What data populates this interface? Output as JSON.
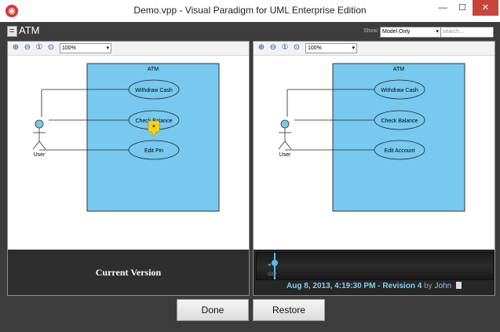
{
  "window": {
    "title": "Demo.vpp - Visual Paradigm for UML Enterprise Edition",
    "minimize": "—",
    "maximize": "☐",
    "close": "✕"
  },
  "header": {
    "diagram_name": "ATM",
    "show_label": "Show:",
    "show_value": "Model Only",
    "search_placeholder": "search..."
  },
  "zoom": {
    "value": "100%"
  },
  "left_pane": {
    "system_name": "ATM",
    "actor": "User",
    "use_cases": [
      "Withdraw Cash",
      "Check Balance",
      "Edit Pin"
    ],
    "caption": "Current Version"
  },
  "right_pane": {
    "system_name": "ATM",
    "actor": "User",
    "use_cases": [
      "Withdraw Cash",
      "Check Balance",
      "Edit Account"
    ],
    "timeline_day": "day",
    "revision_date": "Aug 8, 2013, 4:19:30 PM - Revision 4",
    "revision_by": "by",
    "revision_user": "John"
  },
  "buttons": {
    "done": "Done",
    "restore": "Restore"
  },
  "colors": {
    "system_fill": "#77c9f0",
    "usecase_fill": "#77c9f0",
    "accent": "#5fb8e6",
    "marker": "#f4d11c"
  },
  "icons": [
    "app-icon",
    "diagram-icon",
    "zoom-in-icon",
    "zoom-out-icon",
    "zoom-actual-icon",
    "zoom-fit-icon",
    "star-marker-icon",
    "document-icon"
  ]
}
